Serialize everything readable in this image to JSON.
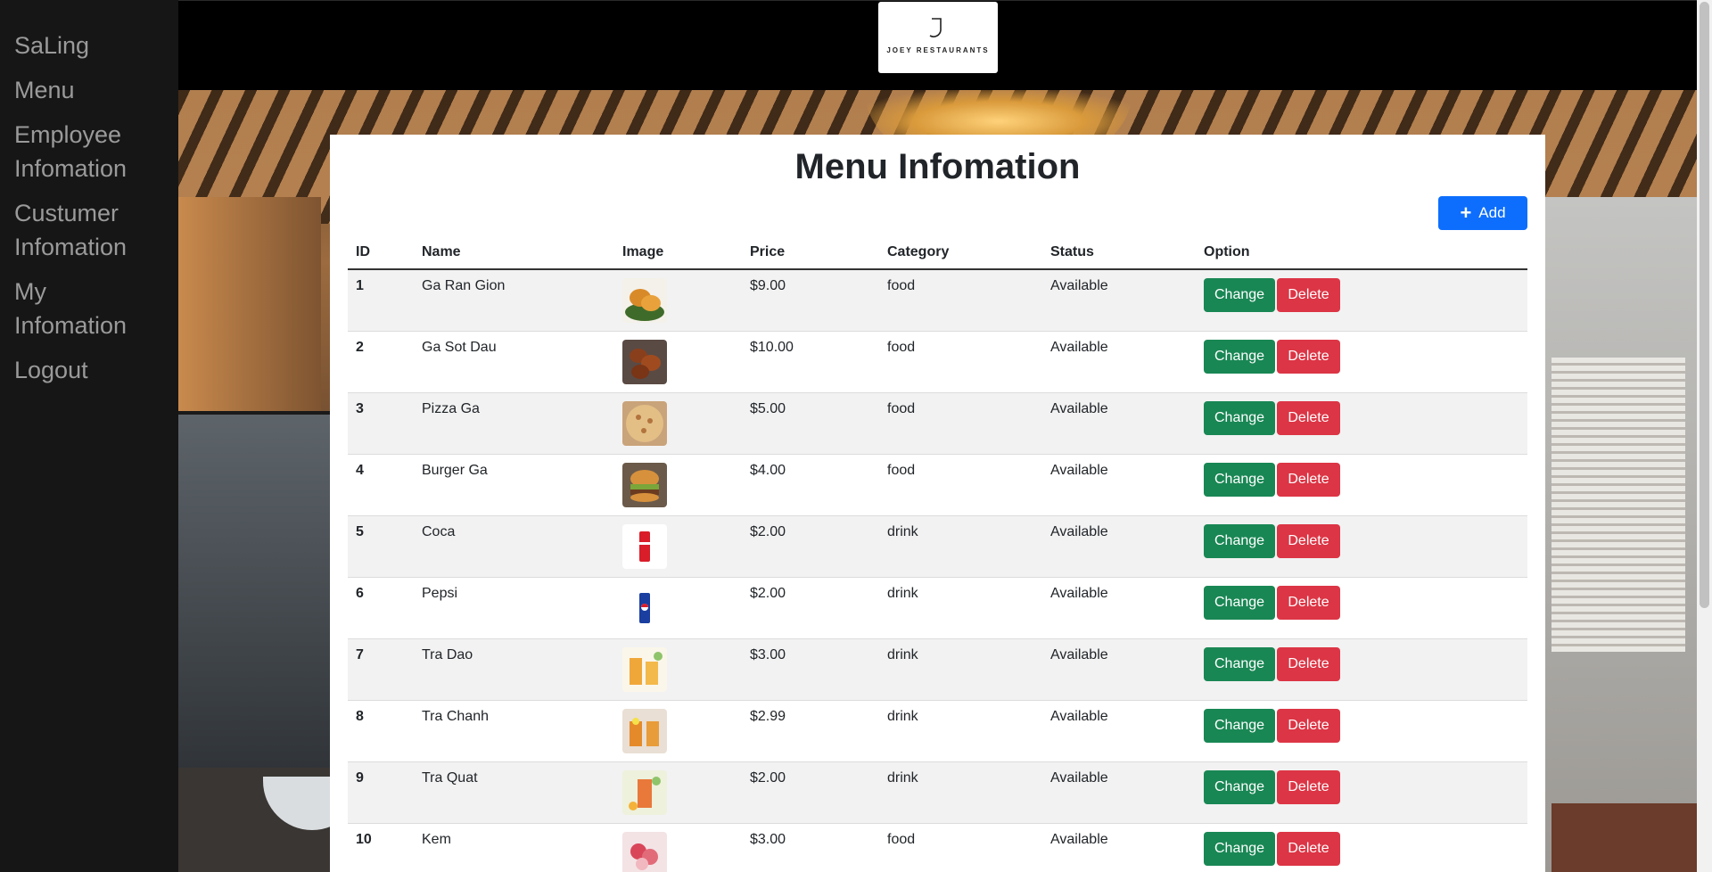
{
  "sidebar": {
    "items": [
      {
        "label": "SaLing"
      },
      {
        "label": "Menu"
      },
      {
        "label": "Employee Infomation"
      },
      {
        "label": "Custumer Infomation"
      },
      {
        "label": "My Infomation"
      },
      {
        "label": "Logout"
      }
    ]
  },
  "header": {
    "logo_text": "JOEY RESTAURANTS"
  },
  "main": {
    "title": "Menu Infomation",
    "add_label": "Add",
    "columns": [
      "ID",
      "Name",
      "Image",
      "Price",
      "Category",
      "Status",
      "Option"
    ],
    "change_label": "Change",
    "delete_label": "Delete",
    "rows": [
      {
        "id": "1",
        "name": "Ga Ran Gion",
        "price": "$9.00",
        "category": "food",
        "status": "Available",
        "image": "fried-chicken"
      },
      {
        "id": "2",
        "name": "Ga Sot Dau",
        "price": "$10.00",
        "category": "food",
        "status": "Available",
        "image": "sauced-chicken"
      },
      {
        "id": "3",
        "name": "Pizza Ga",
        "price": "$5.00",
        "category": "food",
        "status": "Available",
        "image": "pizza"
      },
      {
        "id": "4",
        "name": "Burger Ga",
        "price": "$4.00",
        "category": "food",
        "status": "Available",
        "image": "burger"
      },
      {
        "id": "5",
        "name": "Coca",
        "price": "$2.00",
        "category": "drink",
        "status": "Available",
        "image": "coca-can"
      },
      {
        "id": "6",
        "name": "Pepsi",
        "price": "$2.00",
        "category": "drink",
        "status": "Available",
        "image": "pepsi-can"
      },
      {
        "id": "7",
        "name": "Tra Dao",
        "price": "$3.00",
        "category": "drink",
        "status": "Available",
        "image": "peach-tea"
      },
      {
        "id": "8",
        "name": "Tra Chanh",
        "price": "$2.99",
        "category": "drink",
        "status": "Available",
        "image": "lemon-tea"
      },
      {
        "id": "9",
        "name": "Tra Quat",
        "price": "$2.00",
        "category": "drink",
        "status": "Available",
        "image": "kumquat-tea"
      },
      {
        "id": "10",
        "name": "Kem",
        "price": "$3.00",
        "category": "food",
        "status": "Available",
        "image": "ice-cream"
      }
    ]
  },
  "colors": {
    "primary": "#0d6efd",
    "success": "#198754",
    "danger": "#dc3545",
    "sidebar_bg": "#161616",
    "sidebar_text": "#9a9a9a"
  }
}
